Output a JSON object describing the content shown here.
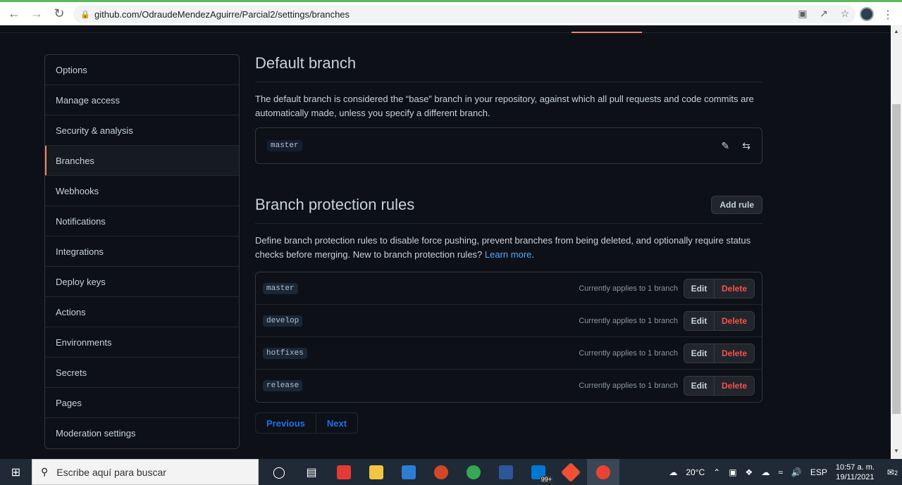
{
  "browser": {
    "url": "github.com/OdraudeMendezAguirre/Parcial2/settings/branches"
  },
  "sidebar": {
    "items": [
      {
        "label": "Options"
      },
      {
        "label": "Manage access"
      },
      {
        "label": "Security & analysis"
      },
      {
        "label": "Branches",
        "active": true
      },
      {
        "label": "Webhooks"
      },
      {
        "label": "Notifications"
      },
      {
        "label": "Integrations"
      },
      {
        "label": "Deploy keys"
      },
      {
        "label": "Actions"
      },
      {
        "label": "Environments"
      },
      {
        "label": "Secrets"
      },
      {
        "label": "Pages"
      },
      {
        "label": "Moderation settings"
      }
    ]
  },
  "default_branch": {
    "title": "Default branch",
    "description": "The default branch is considered the “base” branch in your repository, against which all pull requests and code commits are automatically made, unless you specify a different branch.",
    "branch": "master"
  },
  "protection": {
    "title": "Branch protection rules",
    "add_rule_label": "Add rule",
    "description": "Define branch protection rules to disable force pushing, prevent branches from being deleted, and optionally require status checks before merging. New to branch protection rules?",
    "learn_more": "Learn more",
    "rules": [
      {
        "pattern": "master",
        "applies": "Currently applies to 1 branch",
        "edit": "Edit",
        "delete": "Delete"
      },
      {
        "pattern": "develop",
        "applies": "Currently applies to 1 branch",
        "edit": "Edit",
        "delete": "Delete"
      },
      {
        "pattern": "hotfixes",
        "applies": "Currently applies to 1 branch",
        "edit": "Edit",
        "delete": "Delete"
      },
      {
        "pattern": "release",
        "applies": "Currently applies to 1 branch",
        "edit": "Edit",
        "delete": "Delete"
      }
    ],
    "pager": {
      "previous": "Previous",
      "next": "Next"
    }
  },
  "taskbar": {
    "search_placeholder": "Escribe aquí para buscar",
    "badge": "99+",
    "weather": "20°C",
    "lang": "ESP",
    "time": "10:57 a. m.",
    "date": "19/11/2021",
    "notifications": "2"
  }
}
